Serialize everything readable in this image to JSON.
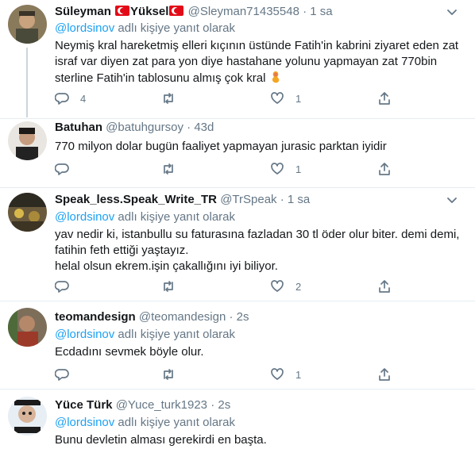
{
  "tweets": [
    {
      "name_part1": "Süleyman",
      "name_part2": "Yüksel",
      "handle": "@Sleyman71435548",
      "dot": "·",
      "time": "1 sa",
      "reply_mention": "@lordsinov",
      "reply_suffix": " adlı kişiye yanıt olarak",
      "lines": [
        "Neymiş kral hareketmiş elleri kıçının üstünde Fatih'in kabrini ziyaret eden zat",
        "israf var diyen zat para yon diye hastahane yolunu yapmayan zat 770bin",
        "sterline Fatih'in tablosunu almış çok kral"
      ],
      "reply_count": "4",
      "retweet_count": "",
      "like_count": "1"
    },
    {
      "name": "Batuhan",
      "handle": "@batuhgursoy",
      "dot": "·",
      "time": "43d",
      "lines": [
        "770 milyon dolar bugün faaliyet yapmayan jurasic parktan iyidir"
      ],
      "reply_count": "",
      "retweet_count": "",
      "like_count": "1"
    },
    {
      "name": "Speak_less.Speak_Write_TR",
      "handle": "@TrSpeak",
      "dot": "·",
      "time": "1 sa",
      "reply_mention": "@lordsinov",
      "reply_suffix": " adlı kişiye yanıt olarak",
      "lines": [
        "yav nedir ki, istanbullu su faturasına fazladan 30 tl öder olur biter. demi demi,",
        "fatihin feth ettiği yaştayız.",
        "helal olsun ekrem.işin çakallığını iyi biliyor."
      ],
      "reply_count": "",
      "retweet_count": "",
      "like_count": "2"
    },
    {
      "name": "teomandesign",
      "handle": "@teomandesign",
      "dot": "·",
      "time": "2s",
      "reply_mention": "@lordsinov",
      "reply_suffix": " adlı kişiye yanıt olarak",
      "lines": [
        "Ecdadını sevmek böyle olur."
      ],
      "reply_count": "",
      "retweet_count": "",
      "like_count": "1"
    },
    {
      "name": "Yüce Türk",
      "handle": "@Yuce_turk1923",
      "dot": "·",
      "time": "2s",
      "reply_mention": "@lordsinov",
      "reply_suffix": " adlı kişiye yanıt olarak",
      "lines": [
        "Bunu devletin alması gerekirdi en başta."
      ]
    }
  ],
  "colors": {
    "link": "#1da1f2",
    "secondary_text": "#657786",
    "divider": "#e6ecf0"
  },
  "icons": {
    "reply": "reply-icon",
    "retweet": "retweet-icon",
    "like": "heart-icon",
    "share": "share-icon",
    "more": "chevron-down-icon",
    "flag": "turkey-flag-icon",
    "emoji": "genie-emoji-icon"
  }
}
